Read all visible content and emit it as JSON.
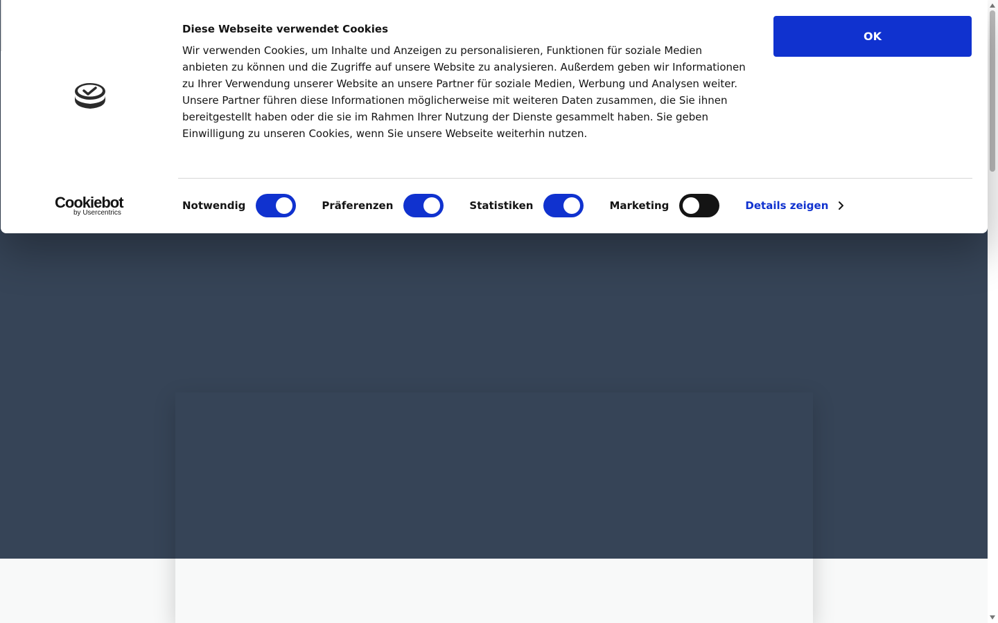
{
  "banner": {
    "title": "Diese Webseite verwendet Cookies",
    "text": "Wir verwenden Cookies, um Inhalte und Anzeigen zu personalisieren, Funktionen für soziale Medien anbieten zu können und die Zugriffe auf unsere Website zu analysieren. Außerdem geben wir Informationen zu Ihrer Verwendung unserer Website an unsere Partner für soziale Medien, Werbung und Analysen weiter. Unsere Partner führen diese Informationen möglicherweise mit weiteren Daten zusammen, die Sie ihnen bereitgestellt haben oder die sie im Rahmen Ihrer Nutzung der Dienste gesammelt haben. Sie geben Einwilligung zu unseren Cookies, wenn Sie unsere Webseite weiterhin nutzen.",
    "ok_label": "OK",
    "details_label": "Details zeigen",
    "logo": {
      "wordmark": "Cookiebot",
      "sub": "by Usercentrics"
    },
    "toggles": [
      {
        "label": "Notwendig",
        "on": true
      },
      {
        "label": "Präferenzen",
        "on": true
      },
      {
        "label": "Statistiken",
        "on": true
      },
      {
        "label": "Marketing",
        "on": false
      }
    ]
  },
  "colors": {
    "accent": "#1032cf",
    "hero_background": "#364457",
    "page_background": "#f8f9f9",
    "text": "#141414"
  },
  "icons": {
    "brand": "stacked-coins-check-icon",
    "details": "chevron-right-icon"
  }
}
